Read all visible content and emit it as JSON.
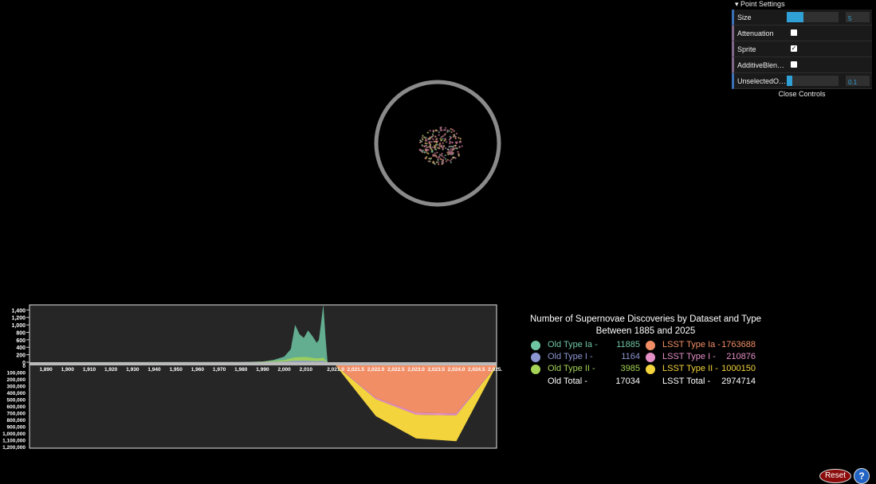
{
  "controls": {
    "title": "Point Settings",
    "size": {
      "label": "Size",
      "value": "5",
      "fraction": 0.33
    },
    "attenuation": {
      "label": "Attenuation",
      "checked": false
    },
    "sprite": {
      "label": "Sprite",
      "checked": true
    },
    "additive": {
      "label": "AdditiveBlending",
      "checked": false
    },
    "unselected": {
      "label": "UnselectedOpa...",
      "value": "0.1",
      "fraction": 0.1
    },
    "close_label": "Close Controls"
  },
  "legend": {
    "title_line1": "Number of Supernovae Discoveries by Dataset and Type",
    "title_line2": "Between 1885 and 2025",
    "old": [
      {
        "label": "Old Type Ia -",
        "value": "11885",
        "color": "#6fc5a3"
      },
      {
        "label": "Old Type I -",
        "value": "1164",
        "color": "#8c96d0"
      },
      {
        "label": "Old Type II -",
        "value": "3985",
        "color": "#a4d356"
      }
    ],
    "old_total_label": "Old Total -",
    "old_total_value": "17034",
    "lsst": [
      {
        "label": "LSST Type Ia -",
        "value": "1763688",
        "color": "#f28e66"
      },
      {
        "label": "LSST Type I -",
        "value": "210876",
        "color": "#e58fc7"
      },
      {
        "label": "LSST Type II -",
        "value": "1000150",
        "color": "#f3d43c"
      }
    ],
    "lsst_total_label": "LSST Total -",
    "lsst_total_value": "2974714"
  },
  "buttons": {
    "reset": "Reset",
    "help": "?"
  },
  "chart_data": [
    {
      "type": "area",
      "title": "",
      "x_ticks": [
        "1,890",
        "1,900",
        "1,910",
        "1,920",
        "1,930",
        "1,940",
        "1,950",
        "1,960",
        "1,970",
        "1,980",
        "1,990",
        "2,000",
        "2,010"
      ],
      "y_ticks": [
        "1,400",
        "1,200",
        "1,000",
        "800",
        "600",
        "400",
        "200",
        "0"
      ],
      "xlim": [
        1885,
        2020
      ],
      "ylim": [
        0,
        1450
      ],
      "series": [
        {
          "name": "Old Type Ia",
          "x": [
            1885,
            1980,
            1990,
            1995,
            2000,
            2003,
            2005,
            2007,
            2009,
            2011,
            2013,
            2015,
            2016,
            2017,
            2018,
            2019,
            2020
          ],
          "values": [
            0,
            5,
            20,
            60,
            150,
            350,
            1000,
            750,
            650,
            850,
            700,
            520,
            600,
            1050,
            1550,
            700,
            0
          ]
        },
        {
          "name": "Old Type I",
          "x": [
            1885,
            1990,
            2000,
            2005,
            2010,
            2015,
            2018,
            2020
          ],
          "values": [
            0,
            5,
            20,
            40,
            40,
            30,
            40,
            0
          ]
        },
        {
          "name": "Old Type II",
          "x": [
            1885,
            1980,
            1990,
            2000,
            2005,
            2010,
            2015,
            2018,
            2020
          ],
          "values": [
            0,
            2,
            15,
            60,
            130,
            140,
            100,
            120,
            0
          ]
        }
      ]
    },
    {
      "type": "area",
      "title": "",
      "x_ticks": [
        "2,021.0",
        "2,021.5",
        "2,022.0",
        "2,022.5",
        "2,023.0",
        "2,023.5",
        "2,024.0",
        "2,024.5",
        "2,025.0"
      ],
      "y_ticks": [
        "0",
        "100,000",
        "200,000",
        "300,000",
        "400,000",
        "500,000",
        "600,000",
        "700,000",
        "800,000",
        "900,000",
        "1,000,000",
        "1,100,000",
        "1,200,000"
      ],
      "xlim": [
        2020.8,
        2025.0
      ],
      "ylim": [
        0,
        1200000
      ],
      "series": [
        {
          "name": "LSST Type Ia",
          "x": [
            2021.0,
            2022.0,
            2023.0,
            2024.0,
            2025.0
          ],
          "values": [
            0,
            480000,
            700000,
            710000,
            0
          ]
        },
        {
          "name": "LSST Type I",
          "x": [
            2021.0,
            2022.0,
            2023.0,
            2024.0,
            2025.0
          ],
          "values": [
            0,
            20000,
            30000,
            30000,
            0
          ]
        },
        {
          "name": "LSST Type II",
          "x": [
            2021.0,
            2022.0,
            2023.0,
            2024.0,
            2025.0
          ],
          "values": [
            0,
            250000,
            350000,
            380000,
            0
          ]
        }
      ]
    }
  ]
}
